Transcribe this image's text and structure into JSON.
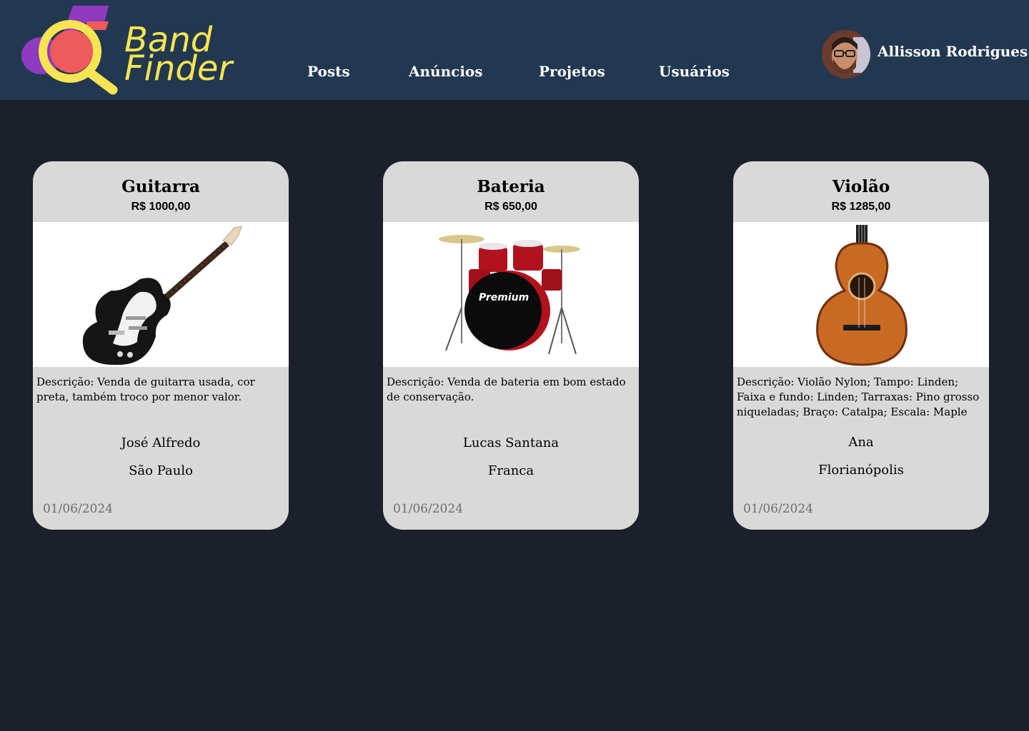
{
  "header": {
    "logo": {
      "line1": "Band",
      "line2": "Finder"
    },
    "nav": [
      {
        "label": "Posts"
      },
      {
        "label": "Anúncios"
      },
      {
        "label": "Projetos"
      },
      {
        "label": "Usuários"
      }
    ],
    "user": {
      "name": "Allisson Rodrigues",
      "avatar_icon": "user-avatar-photo"
    }
  },
  "colors": {
    "header_bg": "#223851",
    "page_bg": "#1b202a",
    "card_bg": "#d9d9d9",
    "logo_yellow": "#f6e452",
    "logo_purple": "#8e3bbf",
    "logo_red": "#ef5a5a"
  },
  "listings": [
    {
      "title": "Guitarra",
      "price": "R$ 1000,00",
      "image_icon": "electric-guitar-image",
      "description": "Descrição: Venda de guitarra usada, cor preta, também  troco por menor valor.",
      "seller": "José Alfredo",
      "city": "São Paulo",
      "date": "01/06/2024"
    },
    {
      "title": "Bateria",
      "price": "R$ 650,00",
      "image_icon": "drum-kit-image",
      "brand_text": "Premium",
      "description": "Descrição: Venda de bateria em bom estado de conservação.",
      "seller": "Lucas Santana",
      "city": "Franca",
      "date": "01/06/2024"
    },
    {
      "title": "Violão",
      "price": "R$ 1285,00",
      "image_icon": "acoustic-guitar-image",
      "description": "Descrição:  Violão Nylon; Tampo: Linden; Faixa e fundo: Linden; Tarraxas: Pino grosso niqueladas; Braço: Catalpa; Escala: Maple",
      "seller": "Ana",
      "city": "Florianópolis",
      "date": "01/06/2024"
    }
  ]
}
